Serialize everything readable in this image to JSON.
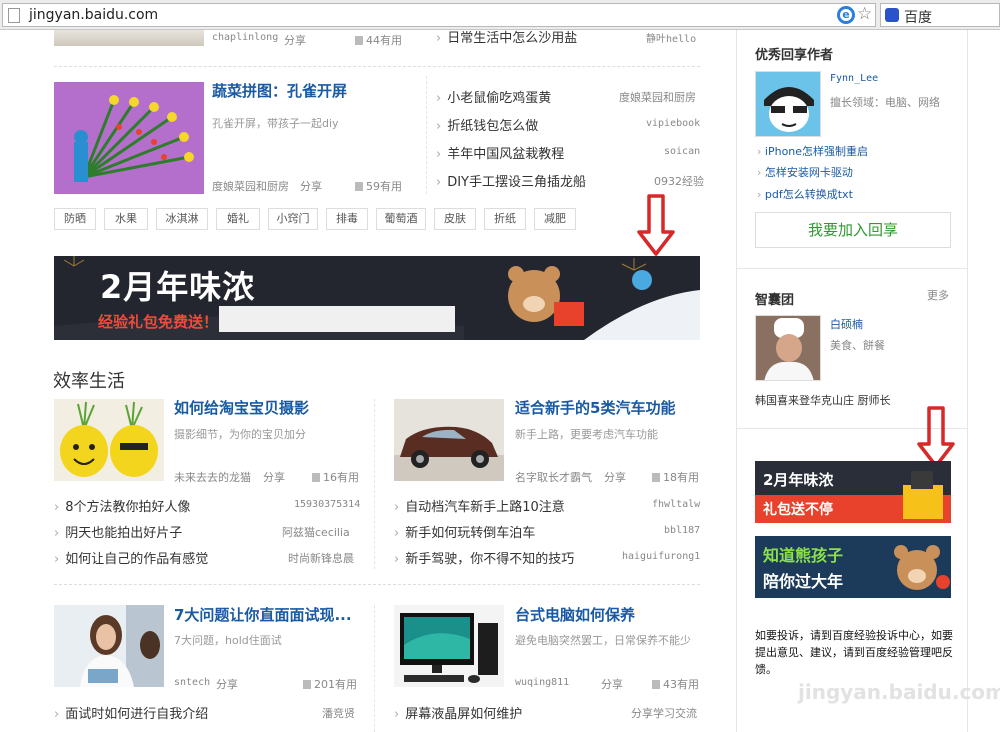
{
  "browser": {
    "url": "jingyan.baidu.com",
    "search_engine": "百度"
  },
  "top_row": {
    "author": "chaplinlong",
    "share": "分享",
    "likes": "44有用",
    "right_item": "日常生活中怎么沙用盐",
    "right_author": "静叶hello"
  },
  "feature": {
    "title": "蔬菜拼图：孔雀开屏",
    "desc": "孔雀开屏，带孩子一起diy",
    "author": "度娘菜园和厨房",
    "share": "分享",
    "likes": "59有用",
    "list": [
      {
        "text": "小老鼠偷吃鸡蛋黄",
        "author": "度娘菜园和厨房"
      },
      {
        "text": "折纸钱包怎么做",
        "author": "vipiebook"
      },
      {
        "text": "羊年中国风盆栽教程",
        "author": "soican"
      },
      {
        "text": "DIY手工摆设三角插龙船",
        "author": "0932经验"
      }
    ]
  },
  "tags": [
    "防晒",
    "水果",
    "冰淇淋",
    "婚礼",
    "小窍门",
    "排毒",
    "葡萄酒",
    "皮肤",
    "折纸",
    "减肥"
  ],
  "banner": {
    "headline": "2月年味浓",
    "sub": "经验礼包免费送！"
  },
  "section": {
    "title": "效率生活",
    "cards": [
      {
        "title": "如何给淘宝宝贝摄影",
        "desc": "摄影细节，为你的宝贝加分",
        "author": "未来去去的龙猫",
        "share": "分享",
        "likes": "16有用",
        "list": [
          {
            "text": "8个方法教你拍好人像",
            "author": "15930375314"
          },
          {
            "text": "阴天也能拍出好片子",
            "author": "阿兹猫cecilia"
          },
          {
            "text": "如何让自己的作品有感觉",
            "author": "时尚新锋息晨"
          }
        ]
      },
      {
        "title": "适合新手的5类汽车功能",
        "desc": "新手上路，更要考虑汽车功能",
        "author": "名字取长才霸气",
        "share": "分享",
        "likes": "18有用",
        "list": [
          {
            "text": "自动档汽车新手上路10注意",
            "author": "fhwltalw"
          },
          {
            "text": "新手如何玩转倒车泊车",
            "author": "bbl187"
          },
          {
            "text": "新手驾驶，你不得不知的技巧",
            "author": "haiguifurong1"
          }
        ]
      },
      {
        "title": "7大问题让你直面面试现...",
        "desc": "7大问题，hold住面试",
        "author": "sntech",
        "share": "分享",
        "likes": "201有用",
        "list": [
          {
            "text": "面试时如何进行自我介绍",
            "author": "潘竞贤"
          }
        ]
      },
      {
        "title": "台式电脑如何保养",
        "desc": "避免电脑突然罢工，日常保养不能少",
        "author": "wuqing811",
        "share": "分享",
        "likes": "43有用",
        "list": [
          {
            "text": "屏幕液晶屏如何维护",
            "author": "分享学习交流"
          }
        ]
      }
    ]
  },
  "sidebar": {
    "author_heading": "优秀回享作者",
    "author_name": "Fynn_Lee",
    "author_field": "擅长领域：电脑、网络",
    "author_links": [
      "iPhone怎样强制重启",
      "怎样安装网卡驱动",
      "pdf怎么转换成txt"
    ],
    "join_button": "我要加入回享",
    "think_tank": "智囊团",
    "more": "更多",
    "expert_name": "白硕楠",
    "expert_tags": "美食、餅餐",
    "expert_title": "韩国喜来登华克山庄 厨师长",
    "ad1_line1": "2月年味浓",
    "ad1_line2": "礼包送不停",
    "ad2_line1": "知道熊孩子",
    "ad2_line2": "陪你过大年",
    "footer_text": "如要投诉，请到百度经验投诉中心，如要提出意见、建议，请到百度经验管理吧反馈。",
    "watermark": "jingyan.baidu.com"
  },
  "colors": {
    "link_blue": "#1a5aa3",
    "green_button": "#2d9a2d",
    "red_arrow": "#d7282a",
    "banner_red": "#e8412c"
  }
}
